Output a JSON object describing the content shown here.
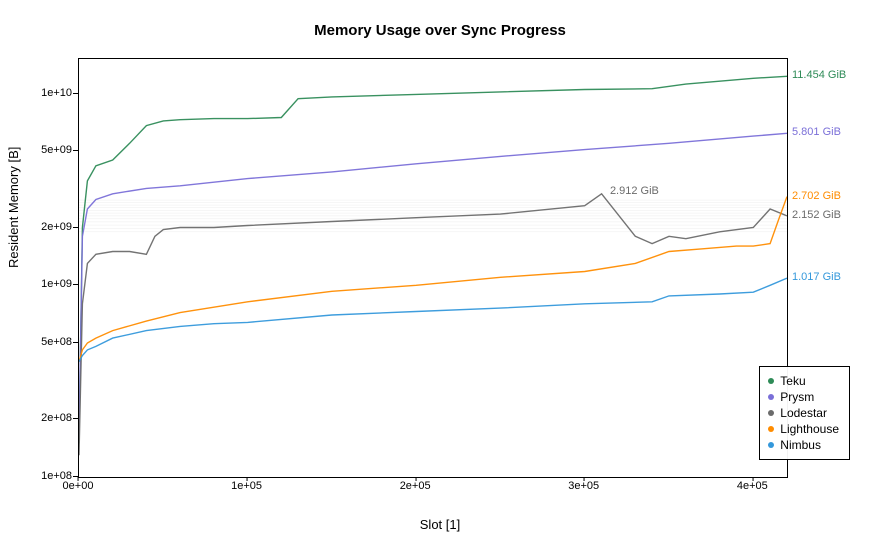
{
  "chart_data": {
    "type": "line",
    "title": "Memory Usage over Sync Progress",
    "xlabel": "Slot [1]",
    "ylabel": "Resident Memory [B]",
    "x_ticks": [
      "0e+00",
      "1e+05",
      "2e+05",
      "3e+05",
      "4e+05"
    ],
    "y_ticks": [
      "1e+08",
      "2e+08",
      "5e+08",
      "1e+09",
      "2e+09",
      "5e+09",
      "1e+10"
    ],
    "xlim": [
      0,
      420000
    ],
    "ylim_log10": [
      8.0,
      10.18
    ],
    "yscale": "log",
    "legend_position": "bottom-right",
    "series": [
      {
        "name": "Teku",
        "color": "#2e8b57",
        "end_label": "11.454 GiB",
        "end_value_bytes": 12298000000,
        "x": [
          0,
          2000,
          5000,
          10000,
          20000,
          30000,
          40000,
          50000,
          60000,
          80000,
          100000,
          120000,
          130000,
          150000,
          200000,
          250000,
          300000,
          340000,
          360000,
          400000,
          420000
        ],
        "y": [
          150000000.0,
          2000000000.0,
          3500000000.0,
          4200000000.0,
          4500000000.0,
          5500000000.0,
          6800000000.0,
          7200000000.0,
          7300000000.0,
          7400000000.0,
          7400000000.0,
          7500000000.0,
          9400000000.0,
          9600000000.0,
          9900000000.0,
          10200000000.0,
          10500000000.0,
          10600000000.0,
          11200000000.0,
          12000000000.0,
          12300000000.0
        ]
      },
      {
        "name": "Prysm",
        "color": "#7a6fd8",
        "end_label": "5.801 GiB",
        "end_value_bytes": 6228000000,
        "x": [
          0,
          2000,
          5000,
          10000,
          20000,
          40000,
          60000,
          100000,
          150000,
          200000,
          250000,
          300000,
          350000,
          400000,
          420000
        ],
        "y": [
          160000000.0,
          1800000000.0,
          2500000000.0,
          2800000000.0,
          3000000000.0,
          3200000000.0,
          3300000000.0,
          3600000000.0,
          3900000000.0,
          4300000000.0,
          4700000000.0,
          5100000000.0,
          5500000000.0,
          6000000000.0,
          6200000000.0
        ]
      },
      {
        "name": "Lodestar",
        "color": "#6b6b6b",
        "end_label": "2.152 GiB",
        "mid_label": "2.912 GiB",
        "end_value_bytes": 2310000000,
        "x": [
          0,
          2000,
          5000,
          10000,
          20000,
          30000,
          40000,
          45000,
          50000,
          60000,
          80000,
          100000,
          150000,
          200000,
          250000,
          300000,
          310000,
          330000,
          340000,
          350000,
          360000,
          380000,
          400000,
          410000,
          420000
        ],
        "y": [
          130000000.0,
          800000000.0,
          1300000000.0,
          1450000000.0,
          1500000000.0,
          1500000000.0,
          1450000000.0,
          1800000000.0,
          1950000000.0,
          2000000000.0,
          2000000000.0,
          2050000000.0,
          2150000000.0,
          2250000000.0,
          2350000000.0,
          2600000000.0,
          3000000000.0,
          1800000000.0,
          1650000000.0,
          1800000000.0,
          1750000000.0,
          1900000000.0,
          2000000000.0,
          2500000000.0,
          2300000000.0
        ]
      },
      {
        "name": "Lighthouse",
        "color": "#ff8c00",
        "end_label": "2.702 GiB",
        "end_value_bytes": 2901000000,
        "x": [
          0,
          2000,
          5000,
          10000,
          20000,
          40000,
          60000,
          100000,
          150000,
          200000,
          250000,
          300000,
          330000,
          350000,
          370000,
          390000,
          400000,
          410000,
          415000,
          420000
        ],
        "y": [
          400000000.0,
          460000000.0,
          500000000.0,
          530000000.0,
          580000000.0,
          650000000.0,
          720000000.0,
          820000000.0,
          930000000.0,
          1000000000.0,
          1100000000.0,
          1180000000.0,
          1300000000.0,
          1500000000.0,
          1550000000.0,
          1600000000.0,
          1600000000.0,
          1650000000.0,
          2200000000.0,
          2900000000.0
        ]
      },
      {
        "name": "Nimbus",
        "color": "#3498db",
        "end_label": "1.017 GiB",
        "end_value_bytes": 1092000000,
        "x": [
          0,
          2000,
          5000,
          10000,
          20000,
          40000,
          60000,
          80000,
          100000,
          150000,
          200000,
          250000,
          300000,
          340000,
          350000,
          380000,
          400000,
          410000,
          420000
        ],
        "y": [
          400000000.0,
          430000000.0,
          460000000.0,
          480000000.0,
          530000000.0,
          580000000.0,
          610000000.0,
          630000000.0,
          640000000.0,
          700000000.0,
          730000000.0,
          760000000.0,
          800000000.0,
          820000000.0,
          880000000.0,
          900000000.0,
          920000000.0,
          1000000000.0,
          1090000000.0
        ]
      }
    ]
  }
}
